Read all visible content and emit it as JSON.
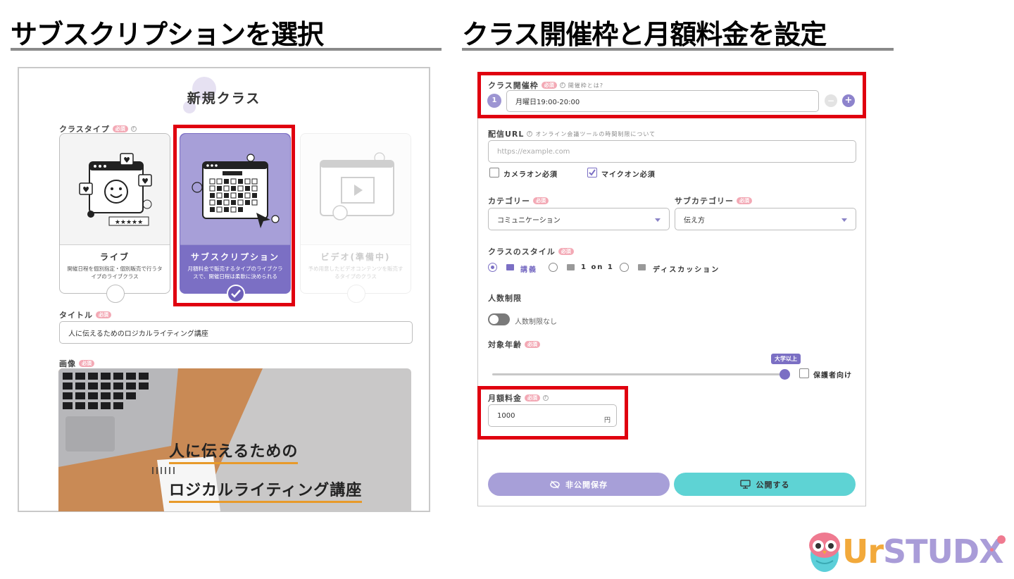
{
  "left_heading": "サブスクリプションを選択",
  "right_heading": "クラス開催枠と月額料金を設定",
  "new_class": {
    "title": "新規クラス",
    "class_type_label": "クラスタイプ",
    "required": "必須",
    "help_mark": "?",
    "cards": [
      {
        "name": "ライブ",
        "desc": "開催日程を個別指定・個別販売で行うタイプのライブクラス"
      },
      {
        "name": "サブスクリプション",
        "desc": "月額料金で販売するタイプのライブクラスで、開催日程は柔軟に決められる"
      },
      {
        "name": "ビデオ(準備中)",
        "desc": "予め用意したビデオコンテンツを販売するタイプのクラス"
      }
    ],
    "rating_stars": "★★★★★",
    "title_label": "タイトル",
    "title_value": "人に伝えるためのロジカルライティング講座",
    "image_label": "画像",
    "hero_line1": "人に伝えるための",
    "hero_line2": "ロジカルライティング講座"
  },
  "settings": {
    "schedule_label": "クラス開催枠",
    "required": "必須",
    "help_mark": "?",
    "schedule_help": "開催枠とは?",
    "slot_number": "1",
    "slot_value": "月曜日19:00-20:00",
    "minus": "−",
    "plus": "+",
    "url_label": "配信URL",
    "url_help": "オンライン会議ツールの時間制限について",
    "url_placeholder": "https://example.com",
    "camera_label": "カメラオン必須",
    "camera_checked": false,
    "mic_label": "マイクオン必須",
    "mic_checked": true,
    "category_label": "カテゴリー",
    "category_value": "コミュニケーション",
    "subcategory_label": "サブカテゴリー",
    "subcategory_value": "伝え方",
    "style_label": "クラスのスタイル",
    "style_options": [
      "講義",
      "1 on 1",
      "ディスカッション"
    ],
    "style_selected": "講義",
    "capacity_label": "人数制限",
    "capacity_toggle_label": "人数制限なし",
    "capacity_on": false,
    "age_label": "対象年齢",
    "age_value": "大学以上",
    "guardian_label": "保護者向け",
    "fee_label": "月額料金",
    "fee_value": "1000",
    "fee_unit": "円",
    "private_save_label": "非公開保存",
    "publish_label": "公開する"
  },
  "logo": {
    "letters": [
      "Ur",
      "STUDX"
    ],
    "colors": {
      "ur": "#f2a93b",
      "studx": "#a99cd8",
      "teal": "#5ccfd9",
      "pink": "#ef7a90"
    }
  },
  "colors": {
    "accent_purple": "#7b6fc4",
    "highlight_red": "#e0000f",
    "publish_teal": "#5ed3d4",
    "private_purple": "#a79fd8"
  }
}
